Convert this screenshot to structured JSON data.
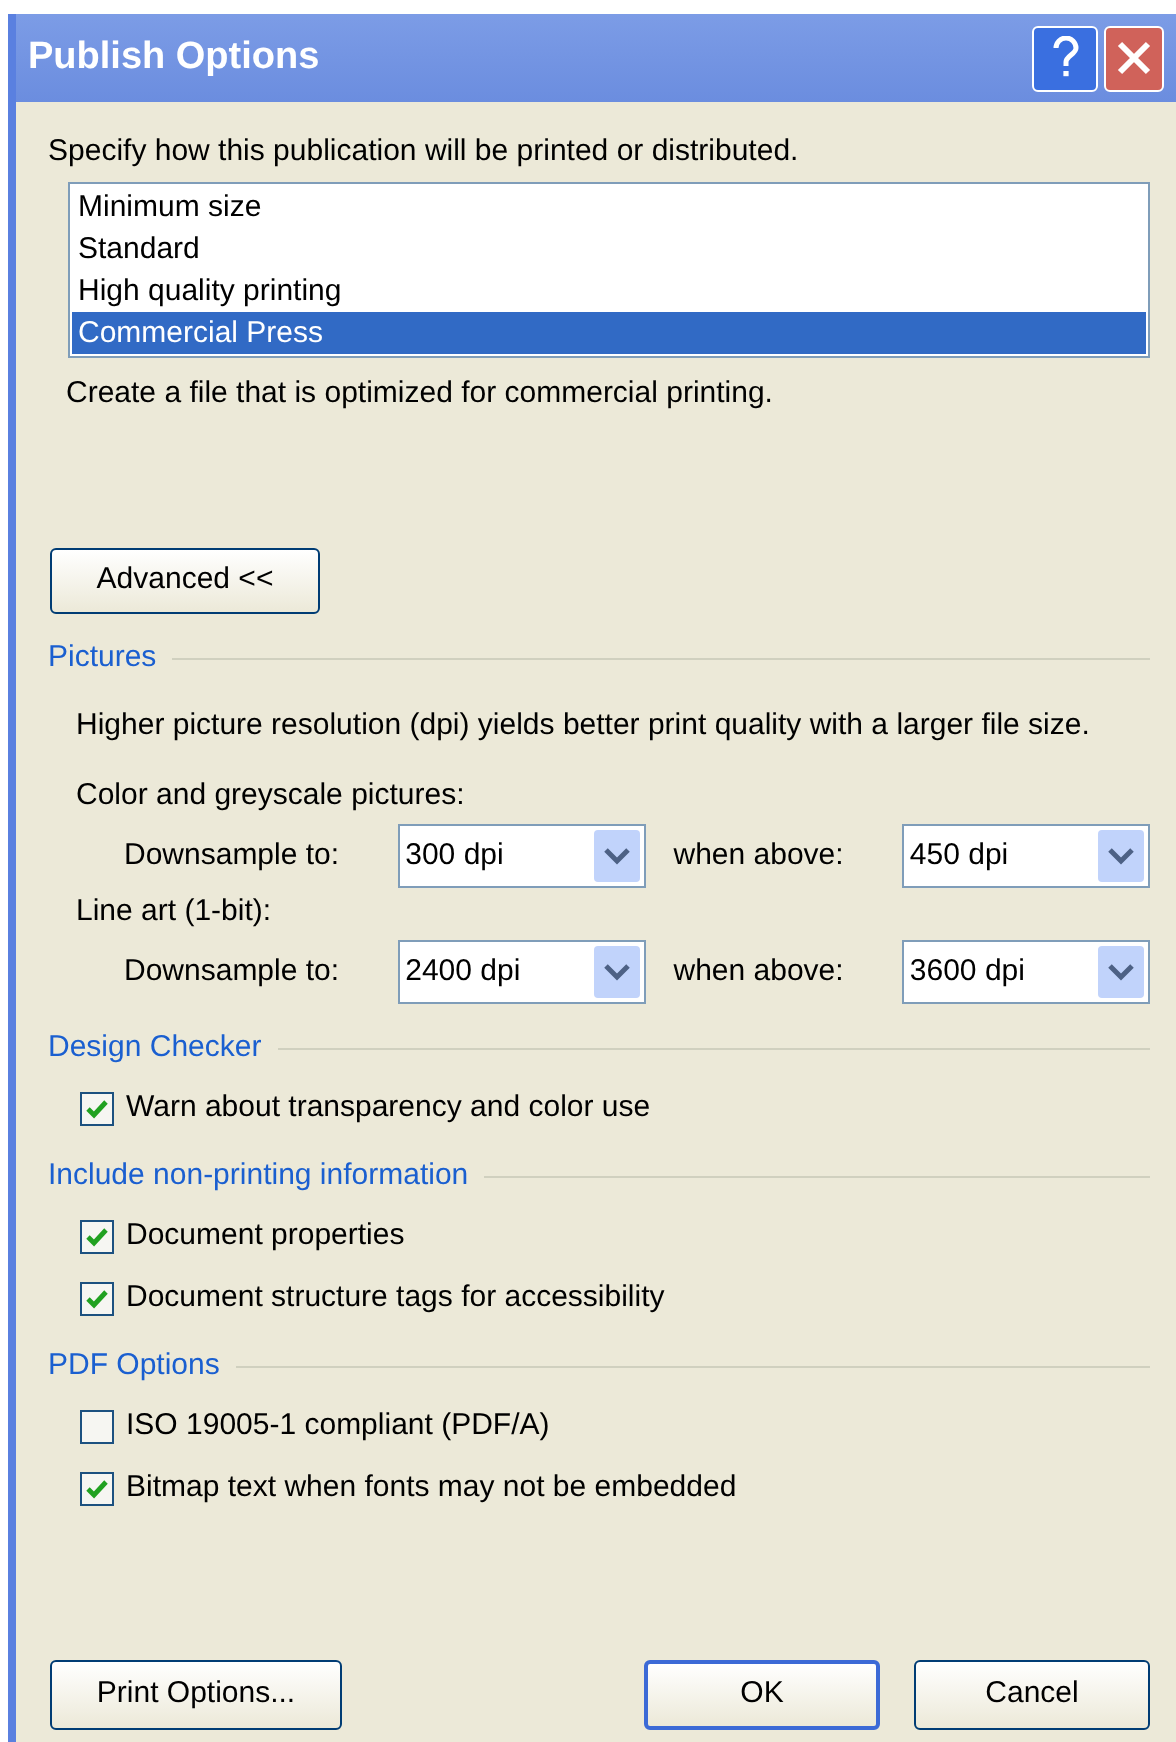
{
  "window": {
    "title": "Publish Options"
  },
  "prompt": "Specify how this publication will be printed or distributed.",
  "presets": [
    {
      "label": "Minimum size",
      "selected": false
    },
    {
      "label": "Standard",
      "selected": false
    },
    {
      "label": "High quality printing",
      "selected": false
    },
    {
      "label": "Commercial Press",
      "selected": true
    }
  ],
  "description": "Create a file that is optimized for commercial printing.",
  "advanced_button": "Advanced <<",
  "sections": [
    {
      "heading": "Pictures",
      "items": [
        {
          "kind": "paragraph",
          "text": "Higher picture resolution (dpi) yields better print quality with a larger file size."
        },
        {
          "kind": "label",
          "text": "Color and greyscale pictures:"
        },
        {
          "kind": "dropdowns",
          "label": "Downsample to:",
          "value": "300 dpi",
          "label_2": "when above:",
          "value_2": "450 dpi"
        },
        {
          "kind": "label",
          "text": "Line art (1-bit):"
        },
        {
          "kind": "dropdowns",
          "label": "Downsample to:",
          "value": "2400 dpi",
          "label_2": "when above:",
          "value_2": "3600 dpi"
        }
      ]
    },
    {
      "heading": "Design Checker",
      "items": [
        {
          "kind": "checkbox",
          "text": "Warn about transparency and color use",
          "checked": true
        }
      ]
    },
    {
      "heading": "Include non-printing information",
      "items": [
        {
          "kind": "checkbox",
          "text": "Document properties",
          "checked": true
        },
        {
          "kind": "checkbox",
          "text": "Document structure tags for accessibility",
          "checked": true
        }
      ]
    },
    {
      "heading": "PDF Options",
      "items": [
        {
          "kind": "checkbox",
          "text": "ISO 19005-1 compliant (PDF/A)",
          "checked": false
        },
        {
          "kind": "checkbox",
          "text": "Bitmap text when fonts may not be embedded",
          "checked": true
        }
      ]
    }
  ],
  "buttons": {
    "print_options": "Print Options...",
    "ok": "OK",
    "cancel": "Cancel"
  }
}
